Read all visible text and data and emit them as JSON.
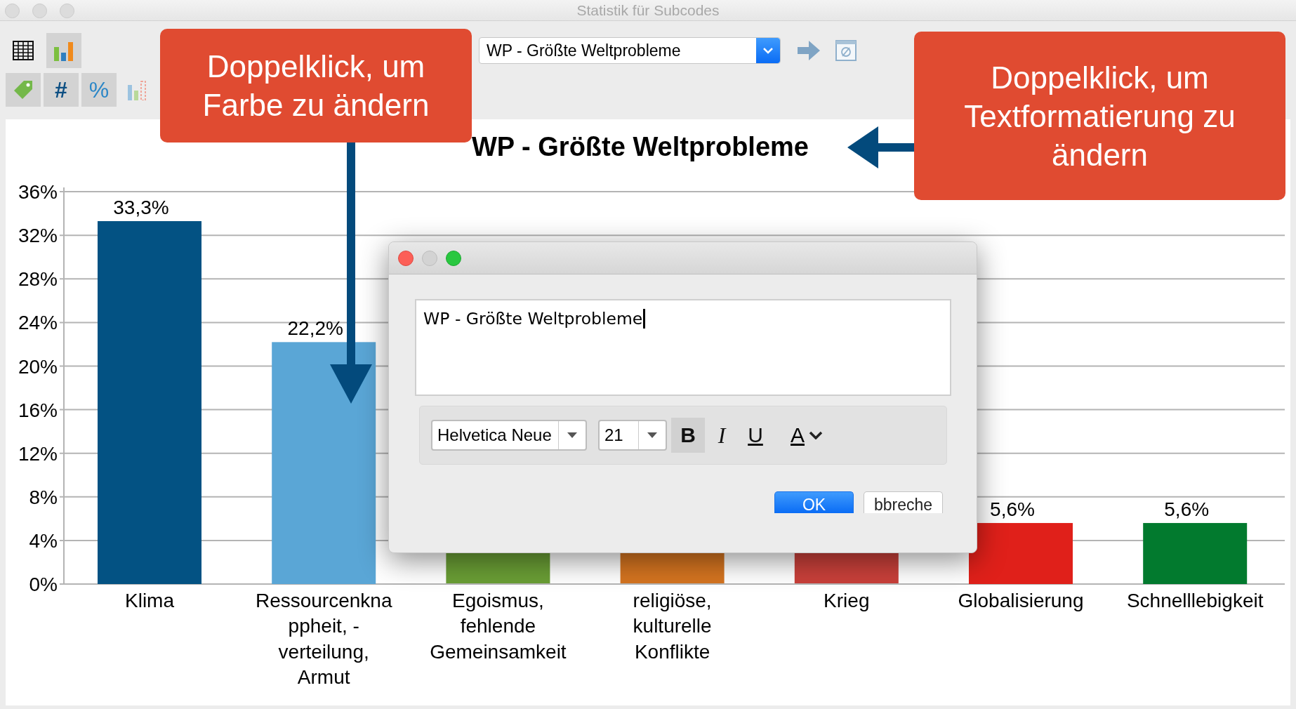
{
  "window": {
    "title": "Statistik für Subcodes"
  },
  "toolbar": {
    "view_buttons": [
      {
        "kind": "table",
        "selected": false
      },
      {
        "kind": "chart",
        "selected": true
      }
    ],
    "code_dropdown": {
      "value": "WP - Größte Weltprobleme"
    },
    "format_buttons": [
      {
        "kind": "tag",
        "selected": true
      },
      {
        "kind": "count",
        "text": "#",
        "selected": true
      },
      {
        "kind": "percent",
        "text": "%",
        "selected": true
      },
      {
        "kind": "chart",
        "selected": false
      }
    ]
  },
  "chart": {
    "chart_data": {
      "type": "bar",
      "title": "WP - Größte Weltprobleme",
      "categories": [
        "Klima",
        "Ressourcenkna\nppheit, -\nverteilung,\nArmut",
        "Egoismus,\nfehlende\nGemeinsamkeit",
        "religiöse,\nkulturelle\nKonflikte",
        "Krieg",
        "Globalisierung",
        "Schnelllebigkeit"
      ],
      "values": [
        33.3,
        22.2,
        null,
        null,
        null,
        5.6,
        5.6
      ],
      "grid": true,
      "colors": [
        "#035283",
        "#5aa6d6",
        "#6a9e35",
        "#d47420",
        "#c9403a",
        "#e0201a",
        "#027a2e"
      ],
      "value_labels": [
        "33,3%",
        "22,2%",
        null,
        null,
        null,
        "5,6%",
        "5,6%"
      ],
      "ylim": [
        0,
        36
      ],
      "yticks": [
        {
          "value": 0,
          "label": "0%"
        },
        {
          "value": 4,
          "label": "4%"
        },
        {
          "value": 8,
          "label": "8%"
        },
        {
          "value": 12,
          "label": "12%"
        },
        {
          "value": 16,
          "label": "16%"
        },
        {
          "value": 20,
          "label": "20%"
        },
        {
          "value": 24,
          "label": "24%"
        },
        {
          "value": 28,
          "label": "28%"
        },
        {
          "value": 32,
          "label": "32%"
        },
        {
          "value": 36,
          "label": "36%"
        }
      ]
    }
  },
  "dialog": {
    "text": "WP - Größte Weltprobleme",
    "font": "Helvetica Neue",
    "size": "21",
    "styles": [
      {
        "kind": "bold",
        "label": "B",
        "on": true
      },
      {
        "kind": "italic",
        "label": "I",
        "on": false
      },
      {
        "kind": "underline",
        "label": "U",
        "on": false
      }
    ],
    "color_label": "A",
    "buttons": [
      {
        "label": "OK",
        "default": true
      },
      {
        "label": "bbreche",
        "default": false
      }
    ]
  },
  "callouts": [
    {
      "text": "Doppelklick, um Farbe zu ändern",
      "kind": "down"
    },
    {
      "text": "Doppelklick, um Textformatierung zu ändern",
      "kind": "left"
    }
  ]
}
